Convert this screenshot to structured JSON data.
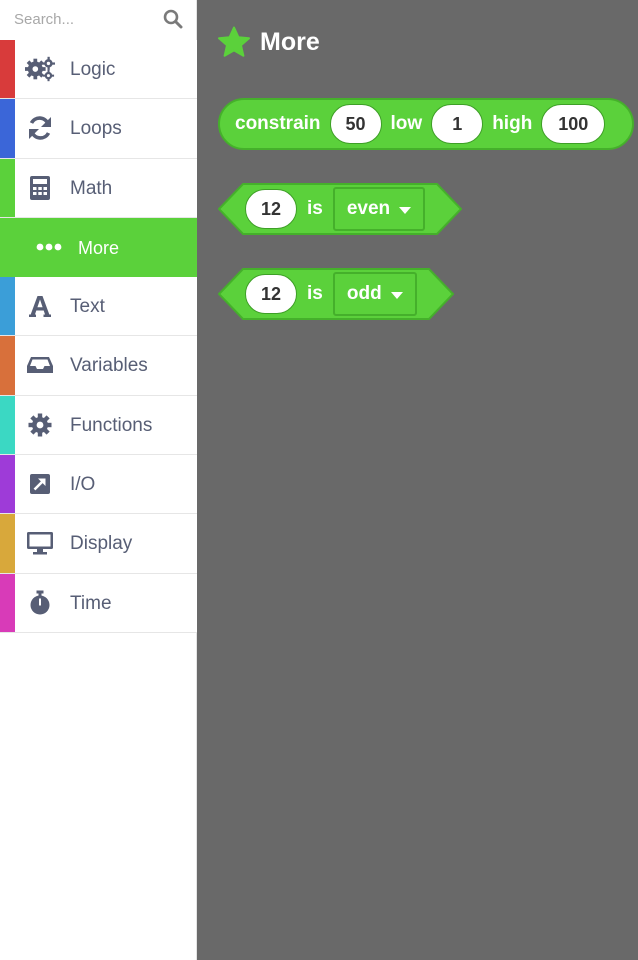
{
  "search": {
    "placeholder": "Search...",
    "icon": "search-icon"
  },
  "categories": [
    {
      "label": "Logic",
      "icon": "gears-icon",
      "color": "#d83b3b"
    },
    {
      "label": "Loops",
      "icon": "refresh-icon",
      "color": "#3b66d8"
    },
    {
      "label": "Math",
      "icon": "calculator-icon",
      "color": "#5bd13b",
      "selected": true
    },
    {
      "label": "More",
      "icon": "ellipsis-icon",
      "color": "#5bd13b",
      "subcategory": true,
      "active": true
    },
    {
      "label": "Text",
      "icon": "font-icon",
      "color": "#3b9ed8"
    },
    {
      "label": "Variables",
      "icon": "inbox-icon",
      "color": "#d8703b"
    },
    {
      "label": "Functions",
      "icon": "cog-icon",
      "color": "#3bd8c3"
    },
    {
      "label": "I/O",
      "icon": "external-arrow-icon",
      "color": "#9e3bd8"
    },
    {
      "label": "Display",
      "icon": "desktop-icon",
      "color": "#d8a83b"
    },
    {
      "label": "Time",
      "icon": "stopwatch-icon",
      "color": "#d83bb8"
    }
  ],
  "flyout": {
    "title": "More",
    "title_icon": "star-icon",
    "accent": "#5bd13b",
    "blocks": {
      "constrain": {
        "label": "constrain",
        "value": "50",
        "low_label": "low",
        "low": "1",
        "high_label": "high",
        "high": "100"
      },
      "even": {
        "value": "12",
        "is_label": "is",
        "option": "even"
      },
      "odd": {
        "value": "12",
        "is_label": "is",
        "option": "odd"
      }
    }
  }
}
